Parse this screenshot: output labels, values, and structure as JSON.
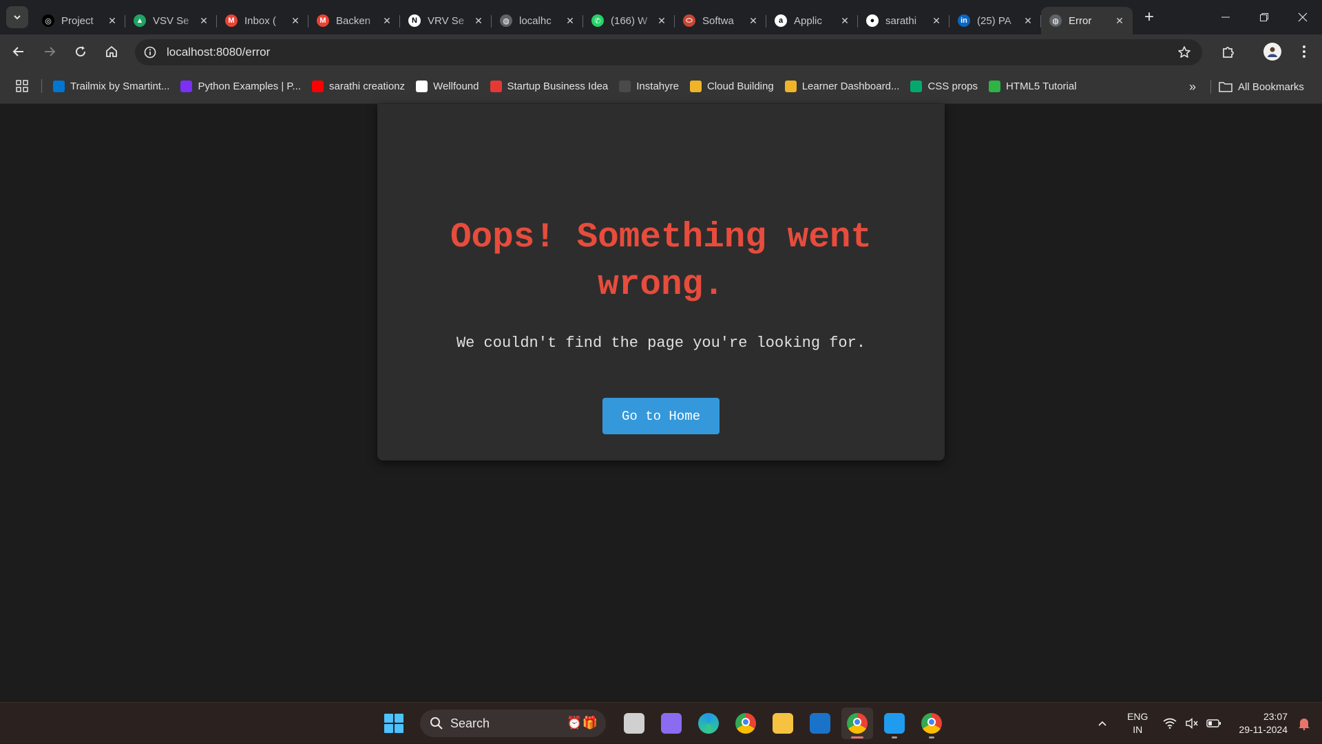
{
  "browser": {
    "tabs": [
      {
        "title": "Project",
        "favicon": "openai-icon",
        "color": "#000000",
        "glyph": "◎"
      },
      {
        "title": "VSV Se",
        "favicon": "google-drive-icon",
        "color": "#1fa463",
        "glyph": "▲"
      },
      {
        "title": "Inbox (",
        "favicon": "gmail-icon",
        "color": "#ea4335",
        "glyph": "M"
      },
      {
        "title": "Backen",
        "favicon": "gmail-icon",
        "color": "#ea4335",
        "glyph": "M"
      },
      {
        "title": "VRV Se",
        "favicon": "notion-icon",
        "color": "#ffffff",
        "glyph": "N"
      },
      {
        "title": "localhc",
        "favicon": "globe-icon",
        "color": "#5f6368",
        "glyph": "◍"
      },
      {
        "title": "(166) W",
        "favicon": "whatsapp-icon",
        "color": "#25d366",
        "glyph": "✆"
      },
      {
        "title": "Softwa",
        "favicon": "oracle-icon",
        "color": "#c74634",
        "glyph": "⬭"
      },
      {
        "title": "Applic",
        "favicon": "amazon-icon",
        "color": "#ffffff",
        "glyph": "a"
      },
      {
        "title": "sarathi",
        "favicon": "github-icon",
        "color": "#ffffff",
        "glyph": "●"
      },
      {
        "title": "(25) PA",
        "favicon": "linkedin-icon",
        "color": "#0a66c2",
        "glyph": "in"
      },
      {
        "title": "Error",
        "favicon": "globe-icon",
        "color": "#5f6368",
        "glyph": "◍",
        "active": true
      }
    ],
    "url": "localhost:8080/error",
    "bookmarks": [
      {
        "label": "Trailmix by Smartint...",
        "favicon": "trailhead-icon",
        "color": "#0176d3"
      },
      {
        "label": "Python Examples | P...",
        "favicon": "python-icon",
        "color": "#7b2ff7"
      },
      {
        "label": "sarathi creationz",
        "favicon": "youtube-icon",
        "color": "#ff0000"
      },
      {
        "label": "Wellfound",
        "favicon": "wellfound-icon",
        "color": "#ffffff"
      },
      {
        "label": "Startup Business Idea",
        "favicon": "paper-plane-icon",
        "color": "#e53935"
      },
      {
        "label": "Instahyre",
        "favicon": "instahyre-icon",
        "color": "#4a4a4a"
      },
      {
        "label": "Cloud Building",
        "favicon": "package-icon",
        "color": "#f0b429"
      },
      {
        "label": "Learner Dashboard...",
        "favicon": "package-icon",
        "color": "#f0b429"
      },
      {
        "label": "CSS props",
        "favicon": "w3schools-icon",
        "color": "#04aa6d"
      },
      {
        "label": "HTML5 Tutorial",
        "favicon": "html5-tutorial-icon",
        "color": "#2fb344"
      }
    ],
    "all_bookmarks_label": "All Bookmarks"
  },
  "page": {
    "title": "Oops! Something went wrong.",
    "message": "We couldn't find the page you're looking for.",
    "button_label": "Go to Home",
    "accent_color": "#e74c3c",
    "button_color": "#3498db"
  },
  "taskbar": {
    "search_label": "Search",
    "apps": [
      {
        "name": "task-view-icon",
        "color": "#d0d0d0"
      },
      {
        "name": "copilot-icon",
        "color": "#8a6cf0"
      },
      {
        "name": "edge-icon",
        "color": "#1e9be6"
      },
      {
        "name": "chrome-icon",
        "color": "#e94235"
      },
      {
        "name": "file-explorer-icon",
        "color": "#f5c242"
      },
      {
        "name": "outlook-icon",
        "color": "#1a73c9"
      },
      {
        "name": "chrome-profile-icon",
        "color": "#e94235",
        "active": true
      },
      {
        "name": "vscode-icon",
        "color": "#1f9cf0"
      },
      {
        "name": "chrome-profile-2-icon",
        "color": "#e94235"
      }
    ],
    "lang_top": "ENG",
    "lang_bottom": "IN",
    "time": "23:07",
    "date": "29-11-2024"
  }
}
